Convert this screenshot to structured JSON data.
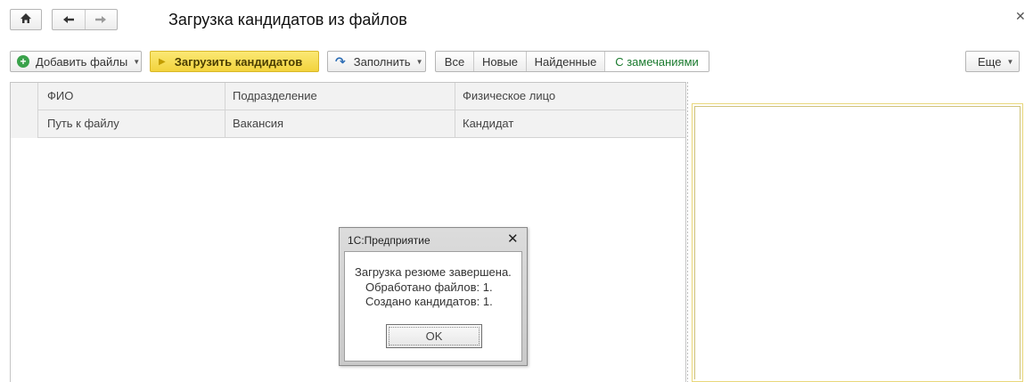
{
  "window": {
    "title": "Загрузка кандидатов из файлов",
    "icons": {
      "home": "home-icon",
      "back": "arrow-left-icon",
      "forward": "arrow-right-icon",
      "close": "close-icon"
    }
  },
  "toolbar": {
    "add_files_label": "Добавить файлы",
    "load_candidates_label": "Загрузить кандидатов",
    "fill_label": "Заполнить",
    "more_label": "Еще",
    "filters": [
      "Все",
      "Новые",
      "Найденные",
      "С замечаниями"
    ],
    "accent": "#f2d33d",
    "active_filter_color": "#1a7a2e"
  },
  "table": {
    "header_row1": [
      "ФИО",
      "Подразделение",
      "Физическое лицо"
    ],
    "header_row2": [
      "Путь к файлу",
      "Вакансия",
      "Кандидат"
    ]
  },
  "dialog": {
    "title": "1С:Предприятие",
    "message_line1": "Загрузка резюме завершена.",
    "message_line2": "Обработано файлов: 1.",
    "message_line3": "Создано кандидатов: 1.",
    "ok_label": "OK"
  }
}
